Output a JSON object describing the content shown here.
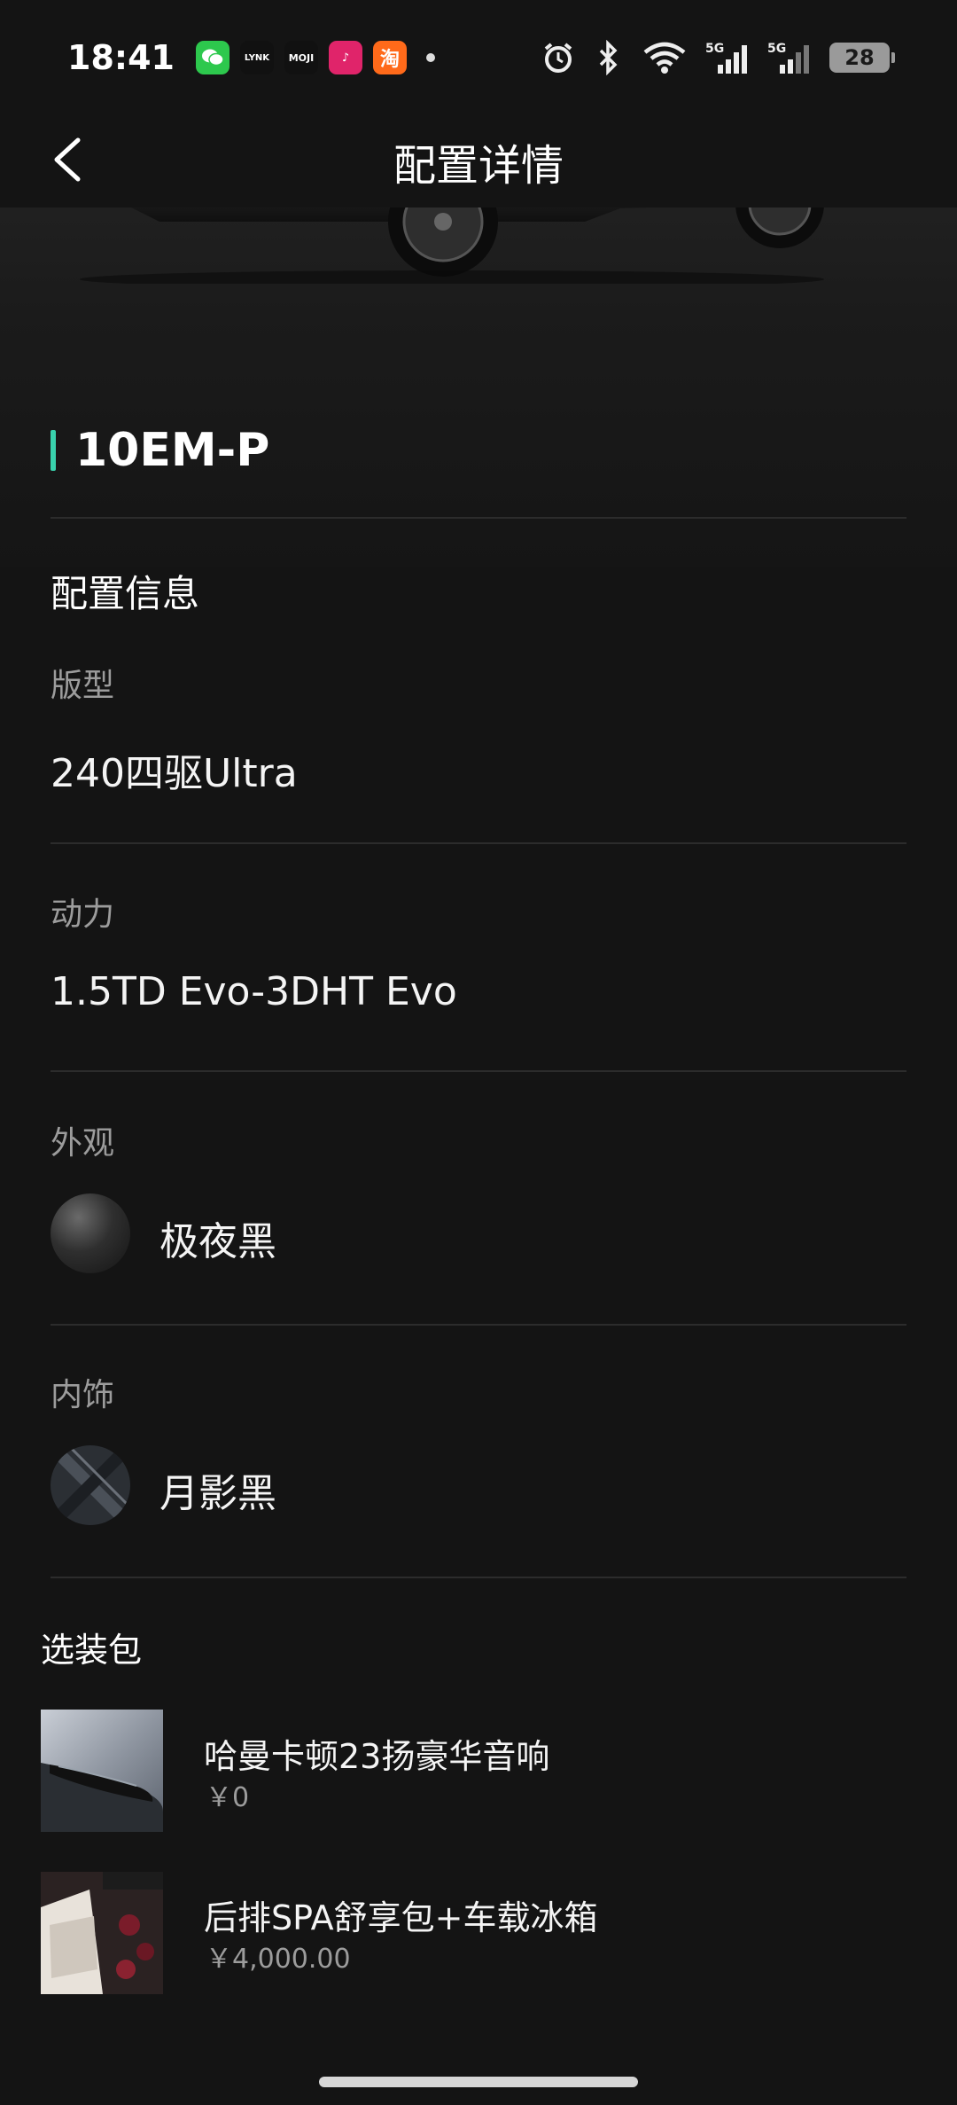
{
  "status_bar": {
    "time": "18:41",
    "battery": "28",
    "apps": [
      {
        "name": "wechat-icon",
        "text": "",
        "color": "#2dc84d"
      },
      {
        "name": "lynk-icon",
        "text": "LYNK",
        "color": "#111111"
      },
      {
        "name": "moji-icon",
        "text": "MOJI",
        "color": "#111111"
      },
      {
        "name": "music-app-icon",
        "text": "♪",
        "color": "#e0246a"
      },
      {
        "name": "taobao-icon",
        "text": "淘",
        "color": "#ff6a1a"
      }
    ]
  },
  "header": {
    "title": "配置详情"
  },
  "model": {
    "name": "10EM-P",
    "accent_color": "#39d2ad"
  },
  "config": {
    "section_title": "配置信息",
    "trim_label": "版型",
    "trim_value": "240四驱Ultra",
    "power_label": "动力",
    "power_value": "1.5TD Evo-3DHT Evo",
    "exterior_label": "外观",
    "exterior_value": "极夜黑",
    "interior_label": "内饰",
    "interior_value": "月影黑"
  },
  "packages": {
    "section_title": "选装包",
    "items": [
      {
        "name": "哈曼卡顿23扬豪华音响",
        "price": "￥0"
      },
      {
        "name": "后排SPA舒享包+车载冰箱",
        "price": "￥4,000.00"
      }
    ]
  }
}
